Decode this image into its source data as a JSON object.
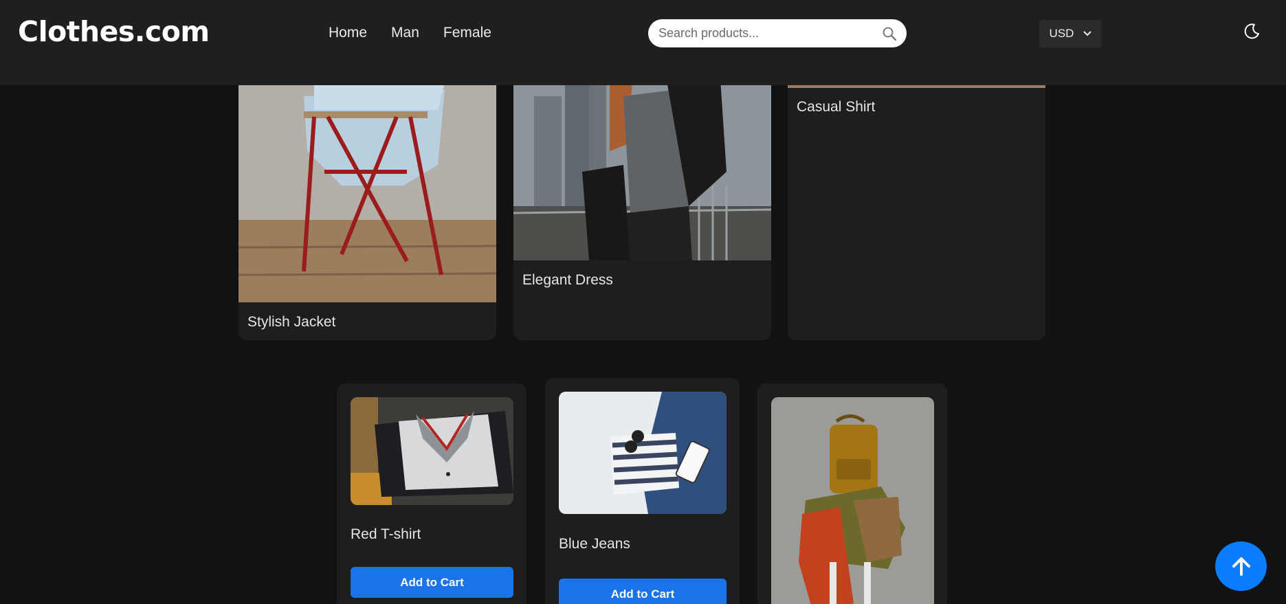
{
  "header": {
    "logo": "Clothes.com",
    "nav": [
      "Home",
      "Man",
      "Female"
    ],
    "search_placeholder": "Search products...",
    "currency": "USD"
  },
  "top_products": [
    {
      "name": "Stylish Jacket"
    },
    {
      "name": "Elegant Dress"
    },
    {
      "name": "Casual Shirt"
    }
  ],
  "products": [
    {
      "name": "Red T-shirt",
      "button": "Add to Cart"
    },
    {
      "name": "Blue Jeans",
      "button": "Add to Cart"
    },
    {
      "name": "",
      "button": ""
    }
  ],
  "colors": {
    "accent": "#1a73e8",
    "back_to_top": "#0a7cff",
    "header_bg": "#1f1f1f",
    "page_bg": "#121212"
  },
  "icons": {
    "search": "search-icon",
    "theme": "moon-icon",
    "back_to_top": "arrow-up-icon"
  }
}
